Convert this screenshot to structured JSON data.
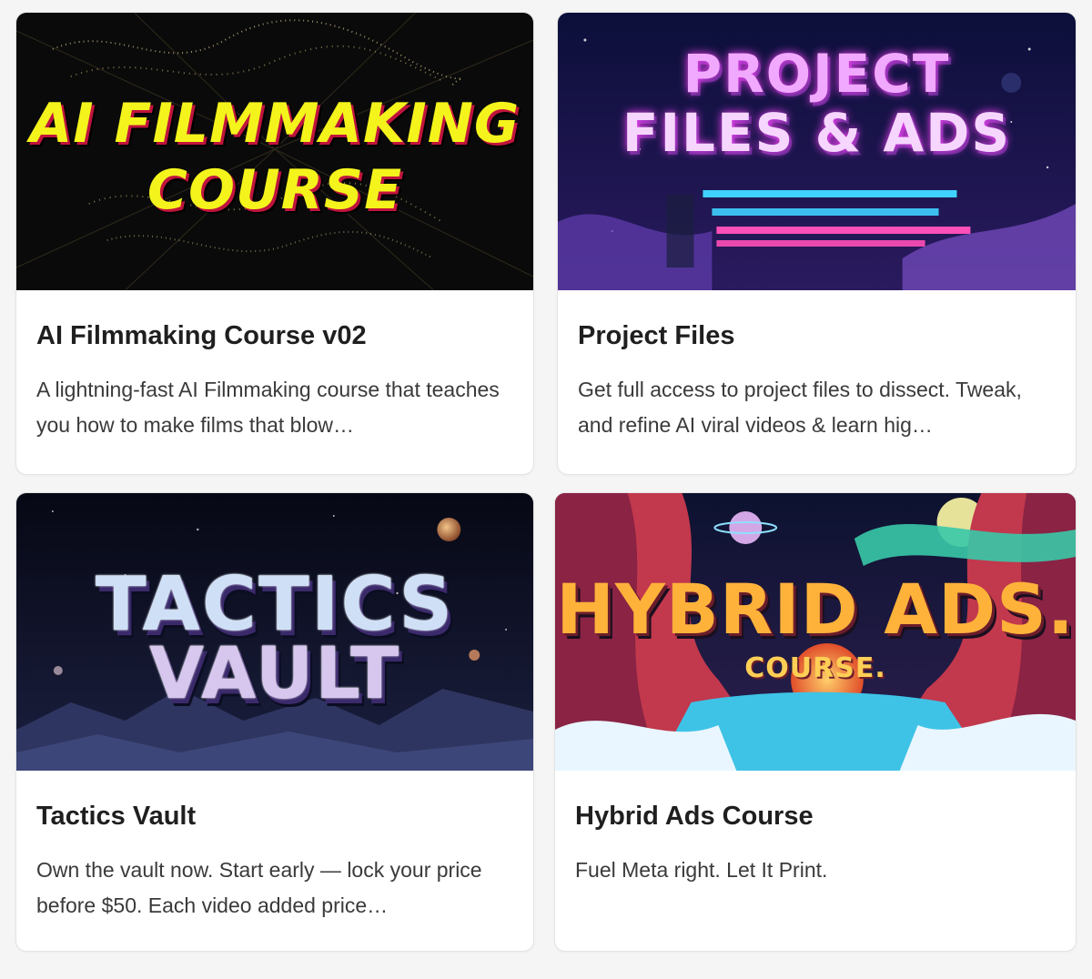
{
  "cards": [
    {
      "thumbnail": {
        "line1": "AI FILMMAKING",
        "line2": "COURSE"
      },
      "title": "AI Filmmaking Course v02",
      "description": "A lightning-fast AI Filmmaking course that teaches you how to make films that blow…"
    },
    {
      "thumbnail": {
        "line1": "PROJECT",
        "line2": "FILES & ADS"
      },
      "title": "Project Files",
      "description": "Get full access to project files to dissect. Tweak, and refine AI viral videos & learn hig…"
    },
    {
      "thumbnail": {
        "line1": "TACTICS",
        "line2": "VAULT"
      },
      "title": "Tactics Vault",
      "description": "Own the vault now. Start early — lock your price before $50. Each video added price…"
    },
    {
      "thumbnail": {
        "line1": "HYBRID ADS.",
        "line2": "COURSE."
      },
      "title": "Hybrid Ads Course",
      "description": "Fuel Meta right. Let It Print."
    }
  ],
  "colors": {
    "page_background": "#f5f5f5",
    "card_background": "#ffffff",
    "title_text": "#1f1f1f",
    "description_text": "#3a3a3a"
  }
}
